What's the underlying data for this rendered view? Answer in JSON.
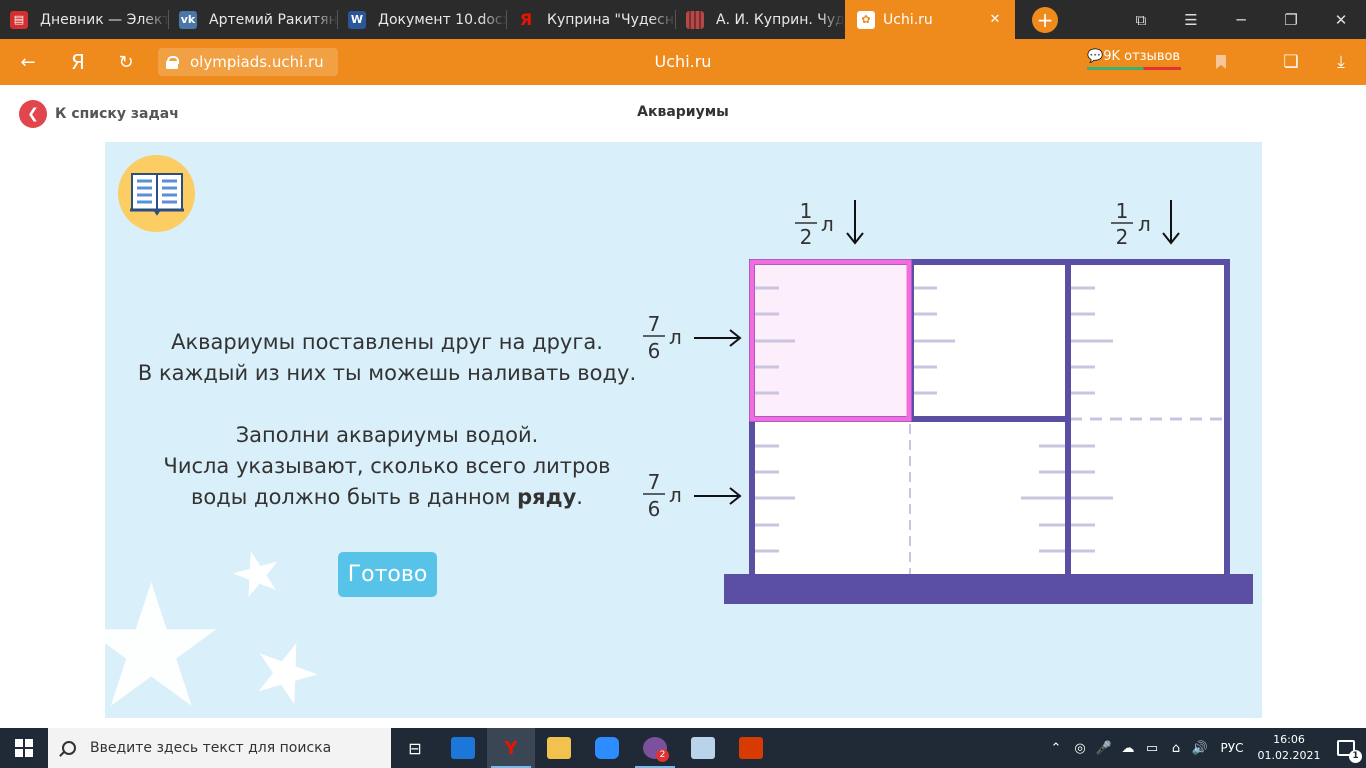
{
  "tabs": [
    {
      "title": "Дневник — Элект",
      "icon": "doc-icon",
      "color": "#d32f2f"
    },
    {
      "title": "Артемий Ракитян",
      "icon": "vk-icon",
      "color": "#4a76a8"
    },
    {
      "title": "Документ 10.docx",
      "icon": "word-icon",
      "color": "#2b579a"
    },
    {
      "title": "Куприна \"Чудесн",
      "icon": "yandex-icon",
      "color": "#e61400"
    },
    {
      "title": "А. И. Куприн. Чуд",
      "icon": "books-icon",
      "color": "#b24a4a"
    },
    {
      "title": "Uchi.ru",
      "icon": "uchi-icon",
      "color": "#ee8b1c",
      "active": true
    }
  ],
  "window_controls": {
    "new_tab": "+"
  },
  "address_bar": {
    "back_glyph": "←",
    "yandex_glyph": "Я",
    "reload_glyph": "↻",
    "url": "olympiads.uchi.ru",
    "site_title": "Uchi.ru",
    "reviews": "9K отзывов"
  },
  "page": {
    "back_link": "К списку задач",
    "title": "Аквариумы"
  },
  "task": {
    "instruction_1": [
      "Аквариумы поставлены друг на друга.",
      "В каждый из них ты можешь наливать воду."
    ],
    "instruction_2": [
      "Заполни аквариумы водой.",
      "Числа указывают, сколько всего литров"
    ],
    "instruction_3_prefix": "воды должно быть в данном ",
    "instruction_3_bold": "ряду",
    "instruction_3_suffix": ".",
    "done_button": "Готово"
  },
  "diagram": {
    "unit": "л",
    "top_labels": [
      {
        "num": "1",
        "den": "2"
      },
      {
        "num": "1",
        "den": "2"
      }
    ],
    "side_labels": [
      {
        "num": "7",
        "den": "6"
      },
      {
        "num": "7",
        "den": "6"
      }
    ],
    "colors": {
      "frame": "#5b4fa4",
      "highlight": "#f26ce0",
      "highlight_fill": "#fdeefb",
      "tick": "#c9c4df"
    }
  },
  "taskbar": {
    "search_placeholder": "Введите здесь текст для поиска",
    "viber_badge": "2",
    "lang": "РУС",
    "time": "16:06",
    "date": "01.02.2021"
  }
}
